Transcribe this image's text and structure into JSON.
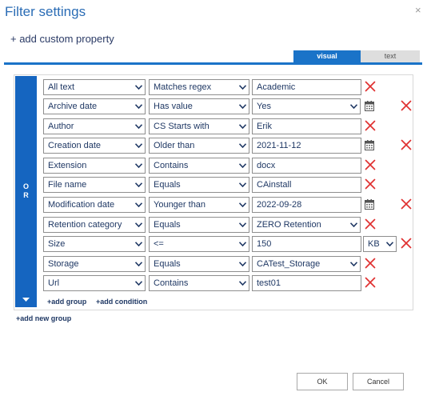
{
  "dialog": {
    "title": "Filter settings",
    "close_label": "×",
    "add_custom_property": "+ add custom property"
  },
  "tabs": [
    {
      "label": "visual",
      "active": true
    },
    {
      "label": "text",
      "active": false
    }
  ],
  "group": {
    "operator_letters": [
      "O",
      "R"
    ],
    "collapse_icon": "caret-down-icon"
  },
  "rows": [
    {
      "property": "All text",
      "operator": "Matches regex",
      "value": "Academic"
    },
    {
      "property": "Archive date",
      "operator": "Has value",
      "value": "Yes"
    },
    {
      "property": "Author",
      "operator": "CS Starts with",
      "value": "Erik"
    },
    {
      "property": "Creation date",
      "operator": "Older than",
      "value": "2021-11-12"
    },
    {
      "property": "Extension",
      "operator": "Contains",
      "value": "docx"
    },
    {
      "property": "File name",
      "operator": "Equals",
      "value": "CAinstall"
    },
    {
      "property": "Modification date",
      "operator": "Younger than",
      "value": "2022-09-28"
    },
    {
      "property": "Retention category",
      "operator": "Equals",
      "value": "ZERO Retention"
    },
    {
      "property": "Size",
      "operator": "<=",
      "value": "150",
      "unit": "KB"
    },
    {
      "property": "Storage",
      "operator": "Equals",
      "value": "CATest_Storage"
    },
    {
      "property": "Url",
      "operator": "Contains",
      "value": "test01"
    }
  ],
  "links": {
    "add_group": "+add group",
    "add_condition": "+add condition",
    "add_new_group": "+add new group"
  },
  "buttons": {
    "ok": "OK",
    "cancel": "Cancel"
  },
  "colors": {
    "accent": "#1a73c8",
    "or_bar": "#1565c0",
    "delete_x": "#e03030",
    "title": "#2a6cb5"
  }
}
